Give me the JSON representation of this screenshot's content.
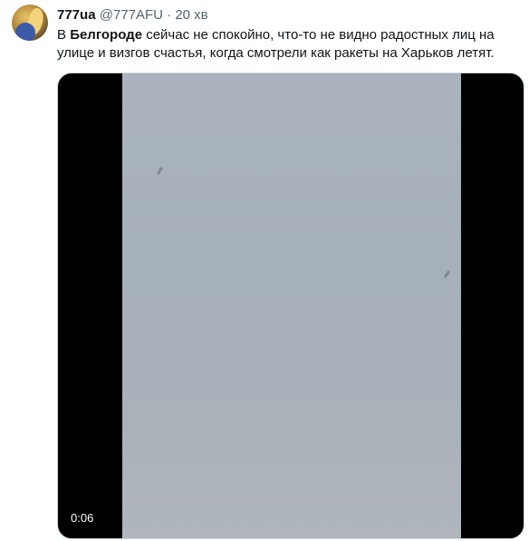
{
  "tweet": {
    "author": {
      "display_name": "777ua",
      "handle": "@777AFU",
      "separator": "·",
      "time": "20 хв"
    },
    "text": {
      "prefix": "В ",
      "bold": "Белгороде",
      "suffix": " сейчас не спокойно, что-то не видно радостных лиц на улице и визгов счастья, когда смотрели как ракеты на Харьков летят."
    },
    "media": {
      "type": "video",
      "duration": "0:06"
    }
  }
}
